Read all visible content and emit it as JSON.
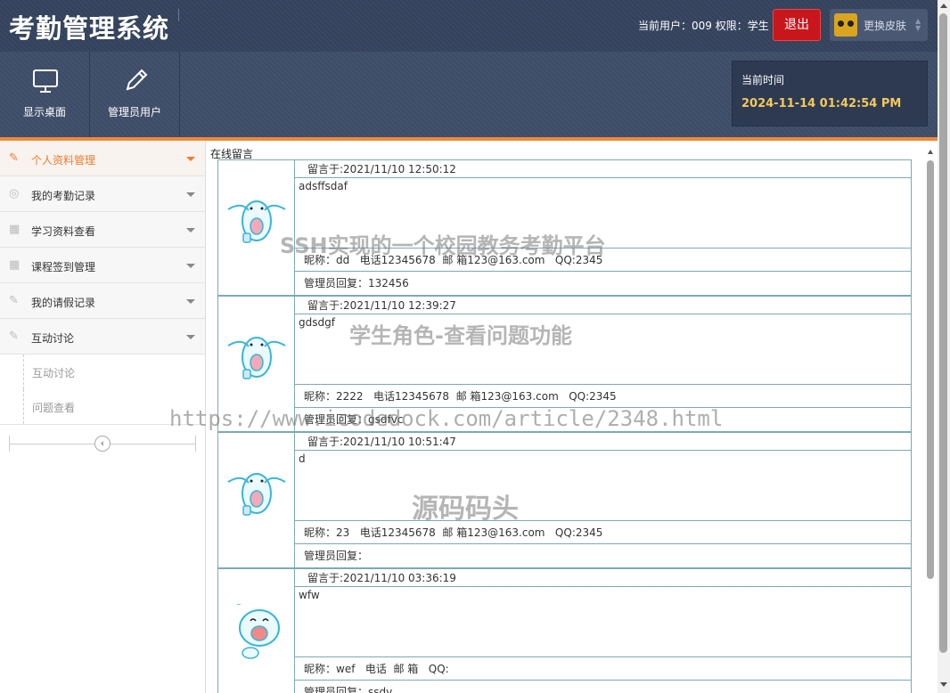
{
  "app": {
    "title": "考勤管理系统"
  },
  "header": {
    "user_info": "当前用户：009 权限：学生",
    "logout_label": "退出",
    "skin_label": "更换皮肤"
  },
  "toolbar": {
    "buttons": [
      {
        "label": "显示桌面",
        "icon": "monitor-icon"
      },
      {
        "label": "管理员用户",
        "icon": "pencil-icon"
      }
    ],
    "time_label": "当前时间",
    "time_value": "2024-11-14 01:42:54 PM"
  },
  "sidebar": {
    "items": [
      {
        "label": "个人资料管理",
        "icon": "pencil-icon",
        "active": true
      },
      {
        "label": "我的考勤记录",
        "icon": "lifebuoy-icon"
      },
      {
        "label": "学习资料查看",
        "icon": "grid-icon"
      },
      {
        "label": "课程签到管理",
        "icon": "grid-icon"
      },
      {
        "label": "我的请假记录",
        "icon": "pencil-icon"
      },
      {
        "label": "互动讨论",
        "icon": "pencil-icon"
      }
    ],
    "sub_items": [
      "互动讨论",
      "问题查看"
    ]
  },
  "content": {
    "title": "在线留言",
    "messages": [
      {
        "date": "留言于:2021/11/10 12:50:12",
        "body": "adsffsdaf",
        "info": "昵称：dd   电话12345678  邮 箱123@163.com   QQ:2345",
        "reply": "管理员回复：132456"
      },
      {
        "date": "留言于:2021/11/10 12:39:27",
        "body": "gdsdgf",
        "info": "昵称：2222   电话12345678  邮 箱123@163.com   QQ:2345",
        "reply": "管理员回复：gsdfvc"
      },
      {
        "date": "留言于:2021/11/10 10:51:47",
        "body": "d",
        "info": "昵称：23   电话12345678  邮 箱123@163.com   QQ:2345",
        "reply": "管理员回复："
      },
      {
        "date": "留言于:2021/11/10 03:36:19",
        "body": "wfw",
        "info": "昵称：wef   电话  邮 箱   QQ:",
        "reply": "管理员回复：ssdv"
      }
    ]
  },
  "watermarks": [
    "SSH实现的一个校园教务考勤平台",
    "学生角色-查看问题功能",
    "https://www.icodedock.com/article/2348.html",
    "源码码头"
  ],
  "colors": {
    "accent": "#f1883a",
    "logout": "#c9161d",
    "header": "#34415a",
    "time": "#f3c95a",
    "border": "#7da9b5"
  }
}
